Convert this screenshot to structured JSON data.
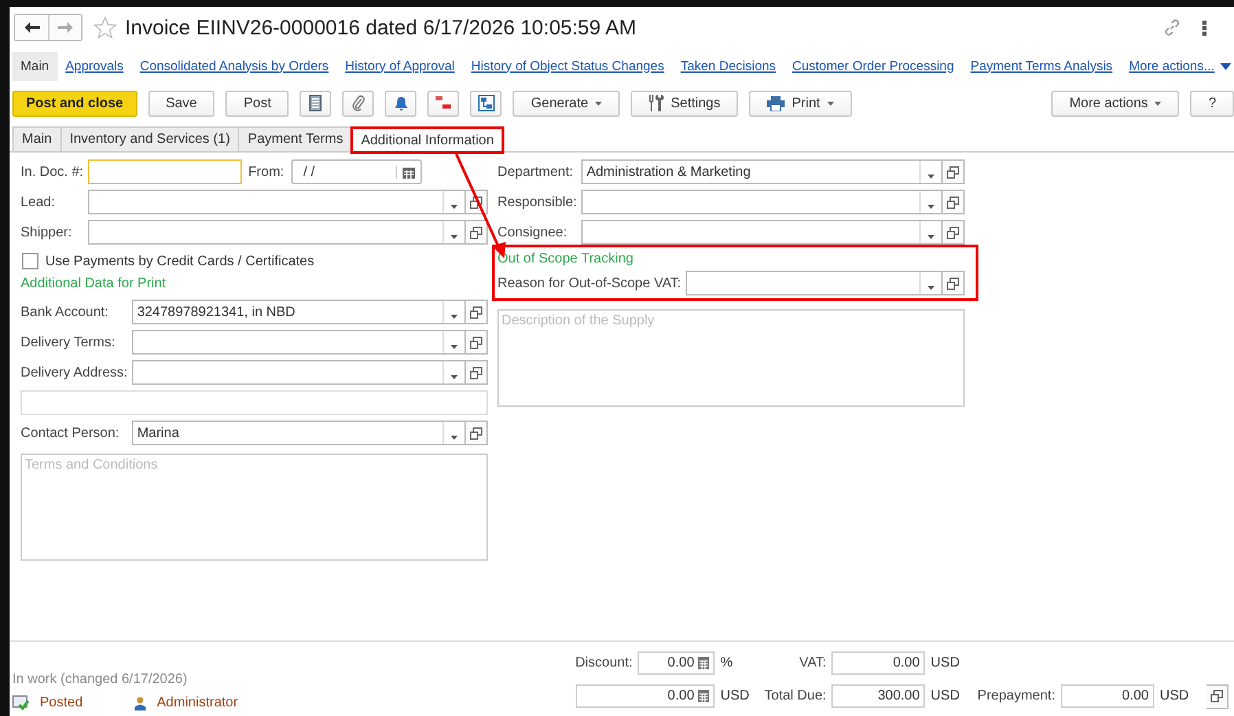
{
  "window": {
    "title": "Invoice EIINV26-0000016 dated 6/17/2026 10:05:59 AM"
  },
  "nav": [
    {
      "label": "Main",
      "selected": true
    },
    {
      "label": "Approvals",
      "selected": false
    },
    {
      "label": "Consolidated Analysis by Orders",
      "selected": false
    },
    {
      "label": "History of Approval",
      "selected": false
    },
    {
      "label": "History of Object Status Changes",
      "selected": false
    },
    {
      "label": "Taken Decisions",
      "selected": false
    },
    {
      "label": "Customer Order Processing",
      "selected": false
    },
    {
      "label": "Payment Terms Analysis",
      "selected": false
    }
  ],
  "nav_more": "More actions...",
  "toolbar": {
    "main": [
      {
        "kind": "primary",
        "label": "Post and close"
      },
      {
        "kind": "plain",
        "label": "Save"
      },
      {
        "kind": "plain",
        "label": "Post"
      }
    ],
    "menus": [
      {
        "kind": "dropdown",
        "label": "Generate"
      },
      {
        "kind": "settings",
        "label": "Settings"
      },
      {
        "kind": "print",
        "label": "Print"
      }
    ],
    "right": [
      {
        "kind": "dropdown",
        "label": "More actions"
      },
      {
        "kind": "plain",
        "label": "?"
      }
    ]
  },
  "tabs": [
    {
      "label": "Main",
      "selected": false,
      "highlighted": false
    },
    {
      "label": "Inventory and Services (1)",
      "selected": false,
      "highlighted": false
    },
    {
      "label": "Payment Terms",
      "selected": false,
      "highlighted": false
    },
    {
      "label": "Additional Information",
      "selected": true,
      "highlighted": true
    }
  ],
  "left": [
    {
      "kind": "fields",
      "rows": [
        {
          "kind": "doc",
          "label": "In. Doc. #:",
          "focused": true,
          "date_label": "From:",
          "date_value": "/ /"
        },
        {
          "kind": "select",
          "label": "Lead:"
        },
        {
          "kind": "select",
          "label": "Shipper:"
        }
      ]
    },
    {
      "kind": "checkbox",
      "label": "Use Payments by Credit Cards / Certificates",
      "checked": false
    },
    {
      "kind": "section",
      "label": "Additional Data for Print"
    },
    {
      "kind": "fields",
      "rows": [
        {
          "kind": "select",
          "label": "Bank Account:",
          "value": "32478978921341, in NBD"
        },
        {
          "kind": "select",
          "label": "Delivery Terms:"
        },
        {
          "kind": "select",
          "label": "Delivery Address:"
        },
        {
          "kind": "blank"
        },
        {
          "kind": "select",
          "label": "Contact Person:",
          "value": "Marina"
        }
      ]
    },
    {
      "kind": "textarea",
      "placeholder": "Terms and Conditions"
    }
  ],
  "right": [
    {
      "kind": "fields",
      "rows": [
        {
          "kind": "select",
          "label": "Department:",
          "value": "Administration & Marketing"
        },
        {
          "kind": "select",
          "label": "Responsible:"
        },
        {
          "kind": "select",
          "label": "Consignee:"
        }
      ]
    },
    {
      "kind": "group",
      "highlighted": true,
      "heading": "Out of Scope Tracking",
      "rows": [
        {
          "kind": "select",
          "label": "Reason for Out-of-Scope VAT:"
        }
      ]
    },
    {
      "kind": "textarea",
      "placeholder": "Description of the Supply"
    }
  ],
  "footer": {
    "status": "In work (changed 6/17/2026)",
    "state": "Posted",
    "author": "Administrator",
    "totals": {
      "discount_label": "Discount:",
      "discount_value": "0.00",
      "discount_unit": "%",
      "vat_label": "VAT:",
      "vat_value": "0.00",
      "vat_unit": "USD",
      "amount_value": "0.00",
      "amount_unit": "USD",
      "total_label": "Total Due:",
      "total_value": "300.00",
      "total_unit": "USD",
      "prepayment_label": "Prepayment:",
      "prepayment_value": "0.00",
      "prepayment_unit": "USD"
    }
  }
}
